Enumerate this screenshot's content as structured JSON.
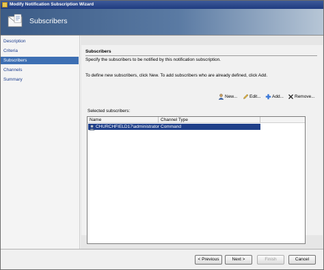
{
  "window": {
    "title": "Modify Notification Subscription Wizard"
  },
  "banner": {
    "title": "Subscribers"
  },
  "nav": {
    "items": [
      {
        "label": "Description",
        "active": false
      },
      {
        "label": "Criteria",
        "active": false
      },
      {
        "label": "Subscribers",
        "active": true
      },
      {
        "label": "Channels",
        "active": false
      },
      {
        "label": "Summary",
        "active": false
      }
    ]
  },
  "page": {
    "heading": "Subscribers",
    "description": "Specify the subscribers to be notified by this notification subscription.",
    "instructions": "To define new subscribers, click New.  To add subscribers who are already defined, click Add."
  },
  "toolbar": {
    "new_label": "New...",
    "edit_label": "Edit...",
    "add_label": "Add...",
    "remove_label": "Remove..."
  },
  "subscribers": {
    "label": "Selected subscribers:",
    "columns": [
      "Name",
      "Channel Type"
    ],
    "rows": [
      {
        "name": "CHURCHFIELD17\\administrator",
        "channel_type": "Command"
      }
    ]
  },
  "footer": {
    "previous_label": "< Previous",
    "next_label": "Next >",
    "finish_label": "Finish",
    "cancel_label": "Cancel"
  },
  "colors": {
    "selection": "#1f3f89",
    "nav_active": "#3d6fb3",
    "nav_link": "#1a3c8e"
  },
  "icons": {
    "banner": "envelope-icon",
    "new": "person-icon",
    "edit": "pencil-icon",
    "add": "plus-icon",
    "remove": "x-icon",
    "row": "user-icon"
  }
}
